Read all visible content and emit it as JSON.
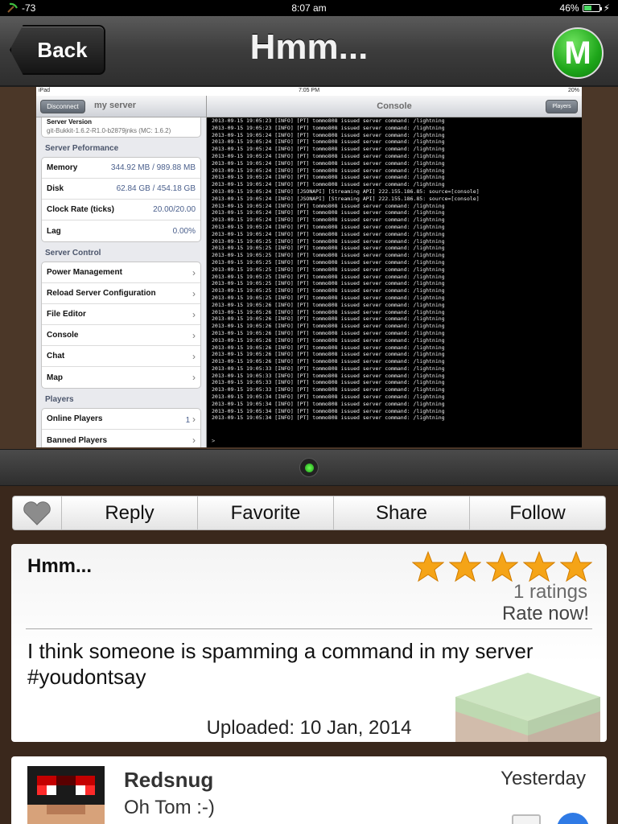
{
  "status_bar": {
    "signal": "-73",
    "time": "8:07 am",
    "battery": "46%",
    "battery_level": 0.46
  },
  "navbar": {
    "back_label": "Back",
    "title": "Hmm...",
    "logo_letter": "M"
  },
  "embedded_screenshot": {
    "status": {
      "left": "iPad",
      "time": "7:05 PM",
      "battery": "20%"
    },
    "master": {
      "disconnect_label": "Disconnect",
      "title": "my server",
      "version_label": "Server Version",
      "version_value": "git-Bukkit-1.6.2-R1.0-b2879jnks (MC: 1.6.2)",
      "performance_header": "Server Peformance",
      "performance": [
        {
          "label": "Memory",
          "value": "344.92 MB / 989.88 MB"
        },
        {
          "label": "Disk",
          "value": "62.84 GB / 454.18 GB"
        },
        {
          "label": "Clock Rate (ticks)",
          "value": "20.00/20.00"
        },
        {
          "label": "Lag",
          "value": "0.00%"
        }
      ],
      "control_header": "Server Control",
      "control": [
        "Power Management",
        "Reload Server Configuration",
        "File Editor",
        "Console",
        "Chat",
        "Map"
      ],
      "players_header": "Players",
      "players": [
        {
          "label": "Online Players",
          "value": "1"
        },
        {
          "label": "Banned Players",
          "value": ""
        }
      ]
    },
    "detail": {
      "title": "Console",
      "players_label": "Players",
      "prompt": ">",
      "log_lines": [
        "2013-09-15 19:05:23 [INFO] [PT] tommo808 issued server command: /lightning",
        "2013-09-15 19:05:23 [INFO] [PT] tommo808 issued server command: /lightning",
        "2013-09-15 19:05:24 [INFO] [PT] tommo808 issued server command: /lightning",
        "2013-09-15 19:05:24 [INFO] [PT] tommo808 issued server command: /lightning",
        "2013-09-15 19:05:24 [INFO] [PT] tommo808 issued server command: /lightning",
        "2013-09-15 19:05:24 [INFO] [PT] tommo808 issued server command: /lightning",
        "2013-09-15 19:05:24 [INFO] [PT] tommo808 issued server command: /lightning",
        "2013-09-15 19:05:24 [INFO] [PT] tommo808 issued server command: /lightning",
        "2013-09-15 19:05:24 [INFO] [PT] tommo808 issued server command: /lightning",
        "2013-09-15 19:05:24 [INFO] [PT] tommo808 issued server command: /lightning",
        "2013-09-15 19:05:24 [INFO] [JSONAPI] [Streaming API] 222.155.186.85: source=[console]",
        "2013-09-15 19:05:24 [INFO] [JSONAPI] [Streaming API] 222.155.186.85: source=[console]",
        "2013-09-15 19:05:24 [INFO] [PT] tommo808 issued server command: /lightning",
        "2013-09-15 19:05:24 [INFO] [PT] tommo808 issued server command: /lightning",
        "2013-09-15 19:05:24 [INFO] [PT] tommo808 issued server command: /lightning",
        "2013-09-15 19:05:24 [INFO] [PT] tommo808 issued server command: /lightning",
        "2013-09-15 19:05:24 [INFO] [PT] tommo808 issued server command: /lightning",
        "2013-09-15 19:05:25 [INFO] [PT] tommo808 issued server command: /lightning",
        "2013-09-15 19:05:25 [INFO] [PT] tommo808 issued server command: /lightning",
        "2013-09-15 19:05:25 [INFO] [PT] tommo808 issued server command: /lightning",
        "2013-09-15 19:05:25 [INFO] [PT] tommo808 issued server command: /lightning",
        "2013-09-15 19:05:25 [INFO] [PT] tommo808 issued server command: /lightning",
        "2013-09-15 19:05:25 [INFO] [PT] tommo808 issued server command: /lightning",
        "2013-09-15 19:05:25 [INFO] [PT] tommo808 issued server command: /lightning",
        "2013-09-15 19:05:25 [INFO] [PT] tommo808 issued server command: /lightning",
        "2013-09-15 19:05:25 [INFO] [PT] tommo808 issued server command: /lightning",
        "2013-09-15 19:05:26 [INFO] [PT] tommo808 issued server command: /lightning",
        "2013-09-15 19:05:26 [INFO] [PT] tommo808 issued server command: /lightning",
        "2013-09-15 19:05:26 [INFO] [PT] tommo808 issued server command: /lightning",
        "2013-09-15 19:05:26 [INFO] [PT] tommo808 issued server command: /lightning",
        "2013-09-15 19:05:26 [INFO] [PT] tommo808 issued server command: /lightning",
        "2013-09-15 19:05:26 [INFO] [PT] tommo808 issued server command: /lightning",
        "2013-09-15 19:05:26 [INFO] [PT] tommo808 issued server command: /lightning",
        "2013-09-15 19:05:26 [INFO] [PT] tommo808 issued server command: /lightning",
        "2013-09-15 19:05:26 [INFO] [PT] tommo808 issued server command: /lightning",
        "2013-09-15 19:05:33 [INFO] [PT] tommo808 issued server command: /lightning",
        "2013-09-15 19:05:33 [INFO] [PT] tommo808 issued server command: /lightning",
        "2013-09-15 19:05:33 [INFO] [PT] tommo808 issued server command: /lightning",
        "2013-09-15 19:05:33 [INFO] [PT] tommo808 issued server command: /lightning",
        "2013-09-15 19:05:34 [INFO] [PT] tommo808 issued server command: /lightning",
        "2013-09-15 19:05:34 [INFO] [PT] tommo808 issued server command: /lightning",
        "2013-09-15 19:05:34 [INFO] [PT] tommo808 issued server command: /lightning",
        "2013-09-15 19:05:34 [INFO] [PT] tommo808 issued server command: /lightning"
      ]
    }
  },
  "actions": {
    "heart_icon": "heart-icon",
    "reply": "Reply",
    "favorite": "Favorite",
    "share": "Share",
    "follow": "Follow"
  },
  "post": {
    "title": "Hmm...",
    "stars": 5,
    "ratings": "1 ratings",
    "rate_now": "Rate now!",
    "body": "I think someone is spamming a command in my server #youdontsay",
    "uploaded": "Uploaded: 10 Jan, 2014"
  },
  "comment": {
    "author": "Redsnug",
    "text": "Oh Tom :-)",
    "date": "Yesterday"
  },
  "colors": {
    "accent_green": "#1ea61a",
    "star_orange": "#f5a417",
    "wood": "#3a281c"
  }
}
